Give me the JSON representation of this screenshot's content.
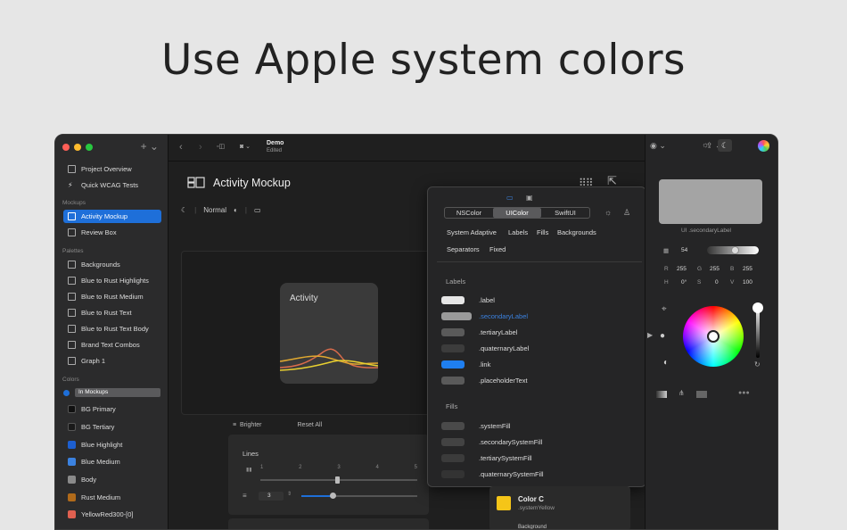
{
  "headline": "Use Apple system colors",
  "toolbar": {
    "doc_title": "Demo",
    "doc_status": "Edited"
  },
  "sidebar": {
    "top_items": [
      {
        "label": "Project Overview"
      },
      {
        "label": "Quick WCAG Tests"
      }
    ],
    "mockups_heading": "Mockups",
    "mockups": [
      {
        "label": "Activity Mockup"
      },
      {
        "label": "Review Box"
      }
    ],
    "palettes_heading": "Palettes",
    "palettes": [
      {
        "label": "Backgrounds"
      },
      {
        "label": "Blue to Rust Highlights"
      },
      {
        "label": "Blue to Rust Medium"
      },
      {
        "label": "Blue to Rust Text"
      },
      {
        "label": "Blue to Rust Text Body"
      },
      {
        "label": "Brand Text Combos"
      },
      {
        "label": "Graph 1"
      }
    ],
    "colors_heading": "Colors",
    "colors_filter": "In Mockups",
    "colors": [
      {
        "label": "BG Primary",
        "color": "#111111"
      },
      {
        "label": "BG Tertiary",
        "color": "#1a1a1a"
      },
      {
        "label": "Blue Highlight",
        "color": "#1d5fd0"
      },
      {
        "label": "Blue Medium",
        "color": "#3b82e0"
      },
      {
        "label": "Body",
        "color": "#8a8a8a"
      },
      {
        "label": "Rust Medium",
        "color": "#b06a1a"
      },
      {
        "label": "YellowRed300-[0]",
        "color": "#e06050"
      }
    ]
  },
  "main": {
    "title": "Activity Mockup",
    "appearance": "Normal",
    "card_title": "Activity",
    "bottom_left": "Brighter",
    "bottom_right": "Reset All",
    "lines_title": "Lines",
    "ticks": [
      "1",
      "2",
      "3",
      "4",
      "5"
    ],
    "stepper_value": "3"
  },
  "popover": {
    "segments": [
      "NSColor",
      "UIColor",
      "SwiftUI"
    ],
    "selected_segment": "UIColor",
    "categories": [
      "System Adaptive",
      "Labels",
      "Fills",
      "Backgrounds",
      "Separators",
      "Fixed"
    ],
    "labels_heading": "Labels",
    "labels": [
      {
        "name": ".label",
        "color": "#e6e6e6",
        "selected": false
      },
      {
        "name": ".secondaryLabel",
        "color": "#9a9a9a",
        "selected": true
      },
      {
        "name": ".tertiaryLabel",
        "color": "#5a5a5a",
        "selected": false
      },
      {
        "name": ".quaternaryLabel",
        "color": "#3c3c3c",
        "selected": false
      },
      {
        "name": ".link",
        "color": "#1f7ff0",
        "selected": false
      },
      {
        "name": ".placeholderText",
        "color": "#5a5a5a",
        "selected": false
      }
    ],
    "fills_heading": "Fills",
    "fills": [
      {
        "name": ".systemFill",
        "color": "#4a4a4a"
      },
      {
        "name": ".secondarySystemFill",
        "color": "#434343"
      },
      {
        "name": ".tertiarySystemFill",
        "color": "#3b3b3b"
      },
      {
        "name": ".quaternarySystemFill",
        "color": "#333333"
      }
    ]
  },
  "inspector": {
    "preview_color": "#a4a4a4",
    "preview_label": "UI .secondaryLabel",
    "opacity": "54",
    "r": "255",
    "g": "255",
    "b": "255",
    "h": "0°",
    "s": "0",
    "v": "100",
    "color_c_title": "Color C",
    "color_c_sub": ".systemYellow",
    "color_c_swatch": "#f5c518",
    "background_label": "Background"
  }
}
